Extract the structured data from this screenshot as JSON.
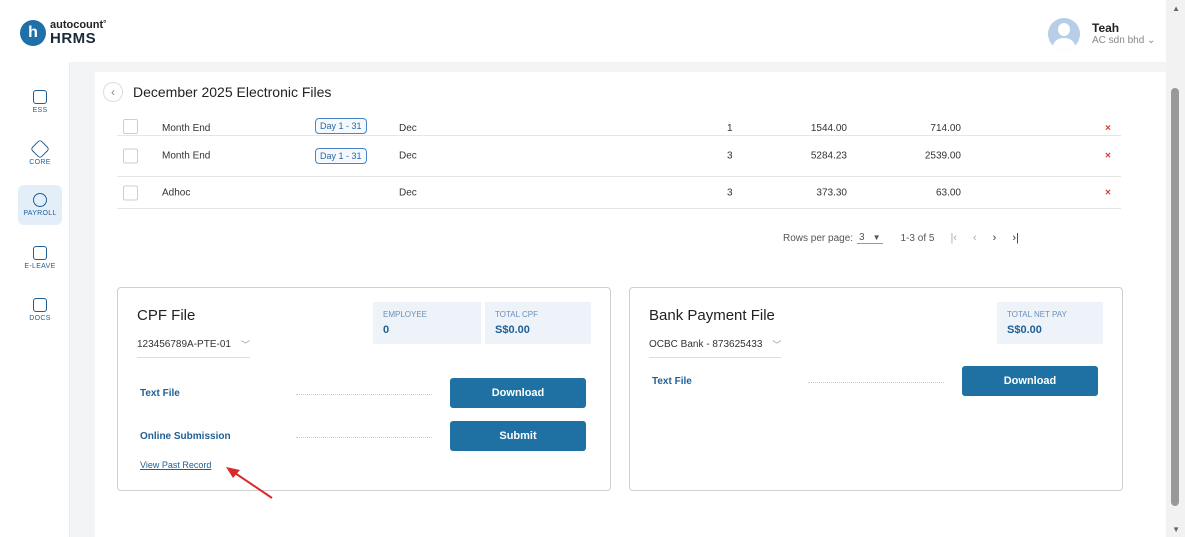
{
  "brand": {
    "logo_letter": "h",
    "small": "autocount",
    "mark": "°",
    "big": "HRMS"
  },
  "user": {
    "name": "Teah",
    "company": "AC sdn bhd ⌄"
  },
  "sidebar": {
    "items": [
      {
        "label": "ESS",
        "icon": "user-card-icon"
      },
      {
        "label": "CORE",
        "icon": "cube-icon"
      },
      {
        "label": "PAYROLL",
        "icon": "dollar-icon"
      },
      {
        "label": "E-LEAVE",
        "icon": "calendar-icon"
      },
      {
        "label": "DOCS",
        "icon": "document-chart-icon"
      }
    ],
    "active": "PAYROLL"
  },
  "page": {
    "back": "‹",
    "title": "December 2025 Electronic Files"
  },
  "table": {
    "rows": [
      {
        "name": "Month End",
        "tag": "Day 1 - 31",
        "month": "Dec",
        "count": "1",
        "gross": "1544.00",
        "net": "714.00",
        "del": "×"
      },
      {
        "name": "Month End",
        "tag": "Day 1 - 31",
        "month": "Dec",
        "count": "3",
        "gross": "5284.23",
        "net": "2539.00",
        "del": "×"
      },
      {
        "name": "Adhoc",
        "tag": "",
        "month": "Dec",
        "count": "3",
        "gross": "373.30",
        "net": "63.00",
        "del": "×"
      }
    ],
    "pager": {
      "label": "Rows per page:",
      "per_page": "3",
      "range": "1-3 of 5",
      "first": "|‹",
      "prev": "‹",
      "next": "›",
      "last": "›|"
    }
  },
  "cpf": {
    "title": "CPF File",
    "account": "123456789A-PTE-01",
    "stats": [
      {
        "label": "EMPLOYEE",
        "value": "0"
      },
      {
        "label": "TOTAL CPF",
        "value": "S$0.00"
      }
    ],
    "text_file": "Text File",
    "download": "Download",
    "online": "Online Submission",
    "submit": "Submit",
    "past_record": "View Past Record"
  },
  "bank": {
    "title": "Bank Payment File",
    "account": "OCBC Bank - 873625433",
    "stats": [
      {
        "label": "TOTAL NET PAY",
        "value": "S$0.00"
      }
    ],
    "text_file": "Text File",
    "download": "Download"
  },
  "colors": {
    "primary": "#1f70a3",
    "delete": "#d83a3a",
    "annotation_arrow": "#d92b2b"
  }
}
